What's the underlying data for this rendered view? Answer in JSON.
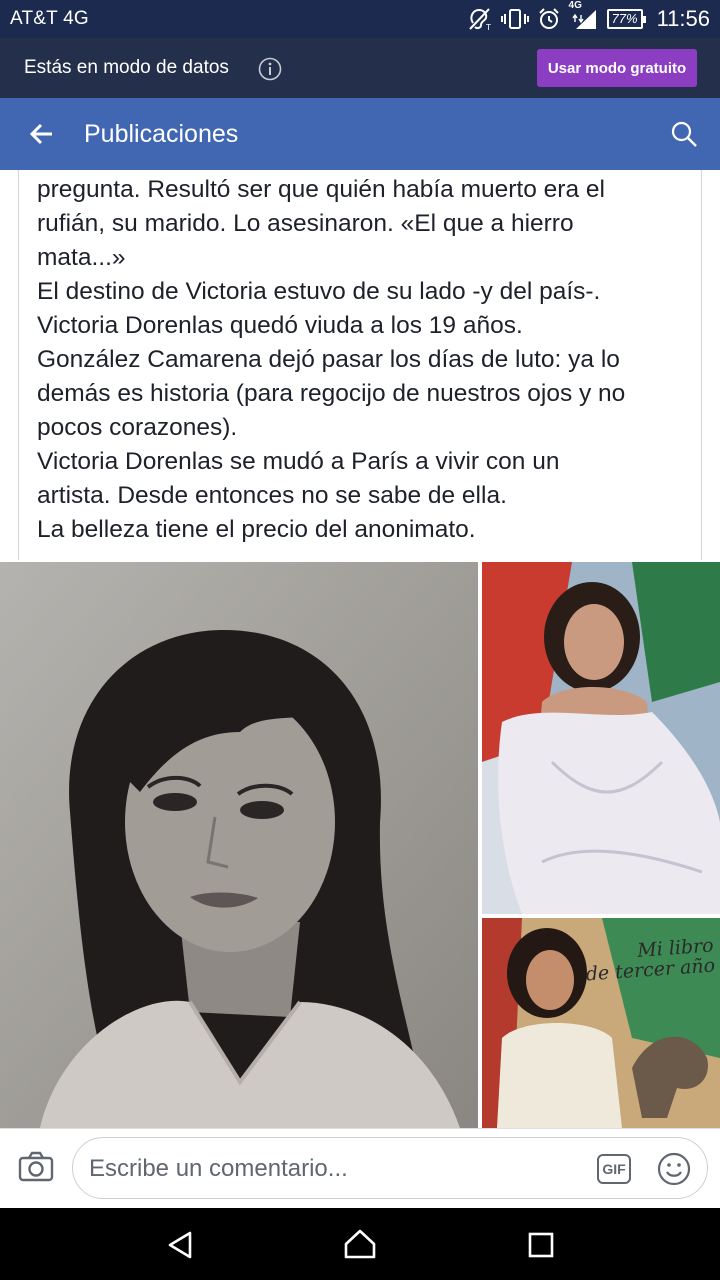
{
  "status_bar": {
    "carrier": "AT&T 4G",
    "network_badge": "4G",
    "battery": "77%",
    "time": "11:56",
    "icons": [
      "hearing-aid-icon",
      "vibrate-icon",
      "alarm-icon",
      "signal-icon",
      "battery-icon"
    ]
  },
  "data_banner": {
    "text": "Estás en modo de datos",
    "button_label": "Usar modo gratuito",
    "button_color": "#8c3ec2"
  },
  "app_bar": {
    "title": "Publicaciones",
    "color": "#4267b2"
  },
  "post": {
    "lines": [
      "pregunta. Resultó ser que quién había muerto era el",
      "rufián, su marido. Lo asesinaron. «El que a hierro",
      "mata...»",
      "El destino de Victoria estuvo de su lado -y del país-.",
      "Victoria Dorenlas quedó viuda a los 19 años.",
      "González Camarena dejó pasar los días de luto: ya lo",
      "demás es historia (para regocijo de nuestros ojos y no",
      "pocos corazones).",
      "Victoria Dorenlas se mudó a París a vivir con un",
      "artista. Desde entonces no se sabe de ella.",
      "La belleza tiene el precio del anonimato."
    ]
  },
  "photos": {
    "bottom_right_caption_line1": "Mi libro",
    "bottom_right_caption_line2": "de tercer año"
  },
  "comment": {
    "placeholder": "Escribe un comentario...",
    "gif_label": "GIF"
  }
}
